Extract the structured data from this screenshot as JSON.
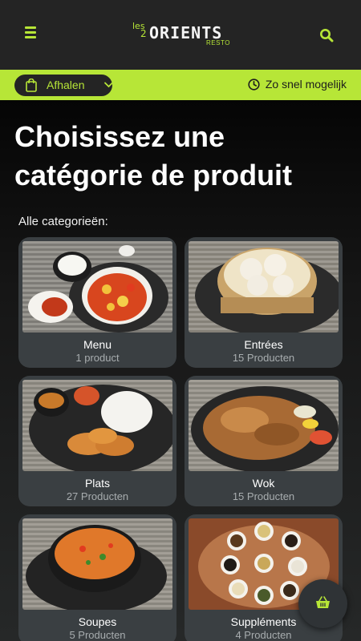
{
  "header": {
    "logo": {
      "prefix": "les",
      "number": "2",
      "name": "ORIENTS",
      "suffix": "RESTO"
    },
    "menu_icon": "hamburger-menu-icon",
    "search_icon": "search-icon"
  },
  "order_bar": {
    "mode_label": "Afhalen",
    "time_label": "Zo snel mogelijk",
    "colors": {
      "accent": "#b7e637",
      "dark": "#242424"
    }
  },
  "main": {
    "title": "Choisissez une catégorie de produit",
    "subtitle": "Alle categorieën:",
    "categories": [
      {
        "name": "Menu",
        "count": "1 product",
        "image": "menu-dish-photo"
      },
      {
        "name": "Entrées",
        "count": "15 Producten",
        "image": "dumplings-photo"
      },
      {
        "name": "Plats",
        "count": "27 Producten",
        "image": "fried-chicken-rice-photo"
      },
      {
        "name": "Wok",
        "count": "15 Producten",
        "image": "wok-noodles-photo"
      },
      {
        "name": "Soupes",
        "count": "5 Producten",
        "image": "soup-bowl-photo"
      },
      {
        "name": "Suppléments",
        "count": "4 Producten",
        "image": "sauces-photo"
      }
    ]
  },
  "cart": {
    "icon": "basket-icon"
  }
}
